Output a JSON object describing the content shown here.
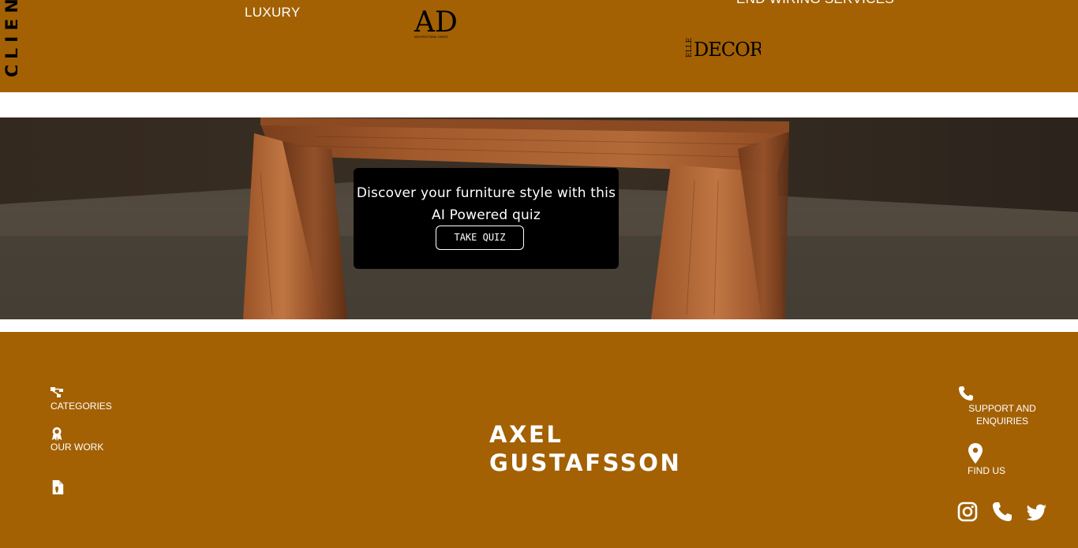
{
  "press": {
    "clientele_label": "CLIENTELE",
    "luxury_label": "LUXURY",
    "ad_logo": "AD",
    "ad_logo_subtext": "ARCHITECTURAL DIGEST",
    "wiring_label": "END WIRING SERVICES",
    "elle_logo_small": "ELLE",
    "elle_logo_main": "DECOR"
  },
  "hero": {
    "quiz_text": "Discover your furniture style with this AI Powered quiz",
    "quiz_button": "TAKE QUIZ"
  },
  "footer": {
    "nav": [
      {
        "label": "CATEGORIES",
        "icon": "sitemap-icon"
      },
      {
        "label": "OUR WORK",
        "icon": "award-icon"
      },
      {
        "label": "",
        "icon": "document-icon"
      }
    ],
    "brand_line1": "AXEL",
    "brand_line2": "GUSTAFSSON",
    "support_line1": "SUPPORT AND",
    "support_line2": "ENQUIRIES",
    "find_us": "FIND US",
    "social": [
      "instagram-icon",
      "phone-icon",
      "twitter-icon"
    ]
  },
  "colors": {
    "brand_brown": "#a36104",
    "white": "#ffffff",
    "black": "#000000"
  }
}
